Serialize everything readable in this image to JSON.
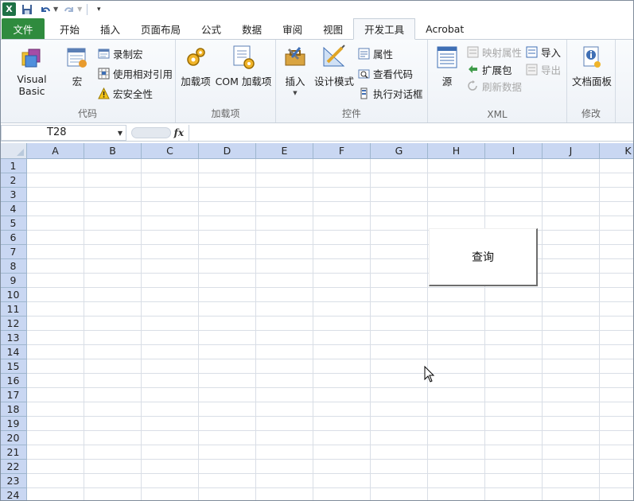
{
  "qat": {
    "logo": "X",
    "save_icon": "save-icon",
    "undo_icon": "undo-icon",
    "redo_icon": "redo-icon",
    "customize_icon": "customize-qat-icon"
  },
  "tabs": [
    {
      "label": "文件"
    },
    {
      "label": "开始"
    },
    {
      "label": "插入"
    },
    {
      "label": "页面布局"
    },
    {
      "label": "公式"
    },
    {
      "label": "数据"
    },
    {
      "label": "审阅"
    },
    {
      "label": "视图"
    },
    {
      "label": "开发工具"
    },
    {
      "label": "Acrobat"
    }
  ],
  "active_tab": "开发工具",
  "ribbon": {
    "code": {
      "label": "代码",
      "visual_basic": "Visual Basic",
      "macros": "宏",
      "record_macro": "录制宏",
      "relative_refs": "使用相对引用",
      "macro_security": "宏安全性"
    },
    "addins": {
      "label": "加载项",
      "addins": "加载项",
      "com_addins": "COM 加载项"
    },
    "controls": {
      "label": "控件",
      "insert": "插入",
      "design_mode": "设计模式",
      "properties": "属性",
      "view_code": "查看代码",
      "run_dialog": "执行对话框"
    },
    "xml": {
      "label": "XML",
      "source": "源",
      "map_properties": "映射属性",
      "expansion_packs": "扩展包",
      "refresh_data": "刷新数据",
      "import": "导入",
      "export": "导出"
    },
    "modify": {
      "label": "修改",
      "document_panel": "文档面板"
    }
  },
  "formula_bar": {
    "name_box": "T28",
    "fx": "fx",
    "content": ""
  },
  "grid": {
    "columns": [
      "A",
      "B",
      "C",
      "D",
      "E",
      "F",
      "G",
      "H",
      "I",
      "J",
      "K"
    ],
    "rows": [
      "1",
      "2",
      "3",
      "4",
      "5",
      "6",
      "7",
      "8",
      "9",
      "10",
      "11",
      "12",
      "13",
      "14",
      "15",
      "16",
      "17",
      "18",
      "19",
      "20",
      "21",
      "22",
      "23",
      "24"
    ]
  },
  "sheet_button": {
    "label": "查询"
  }
}
